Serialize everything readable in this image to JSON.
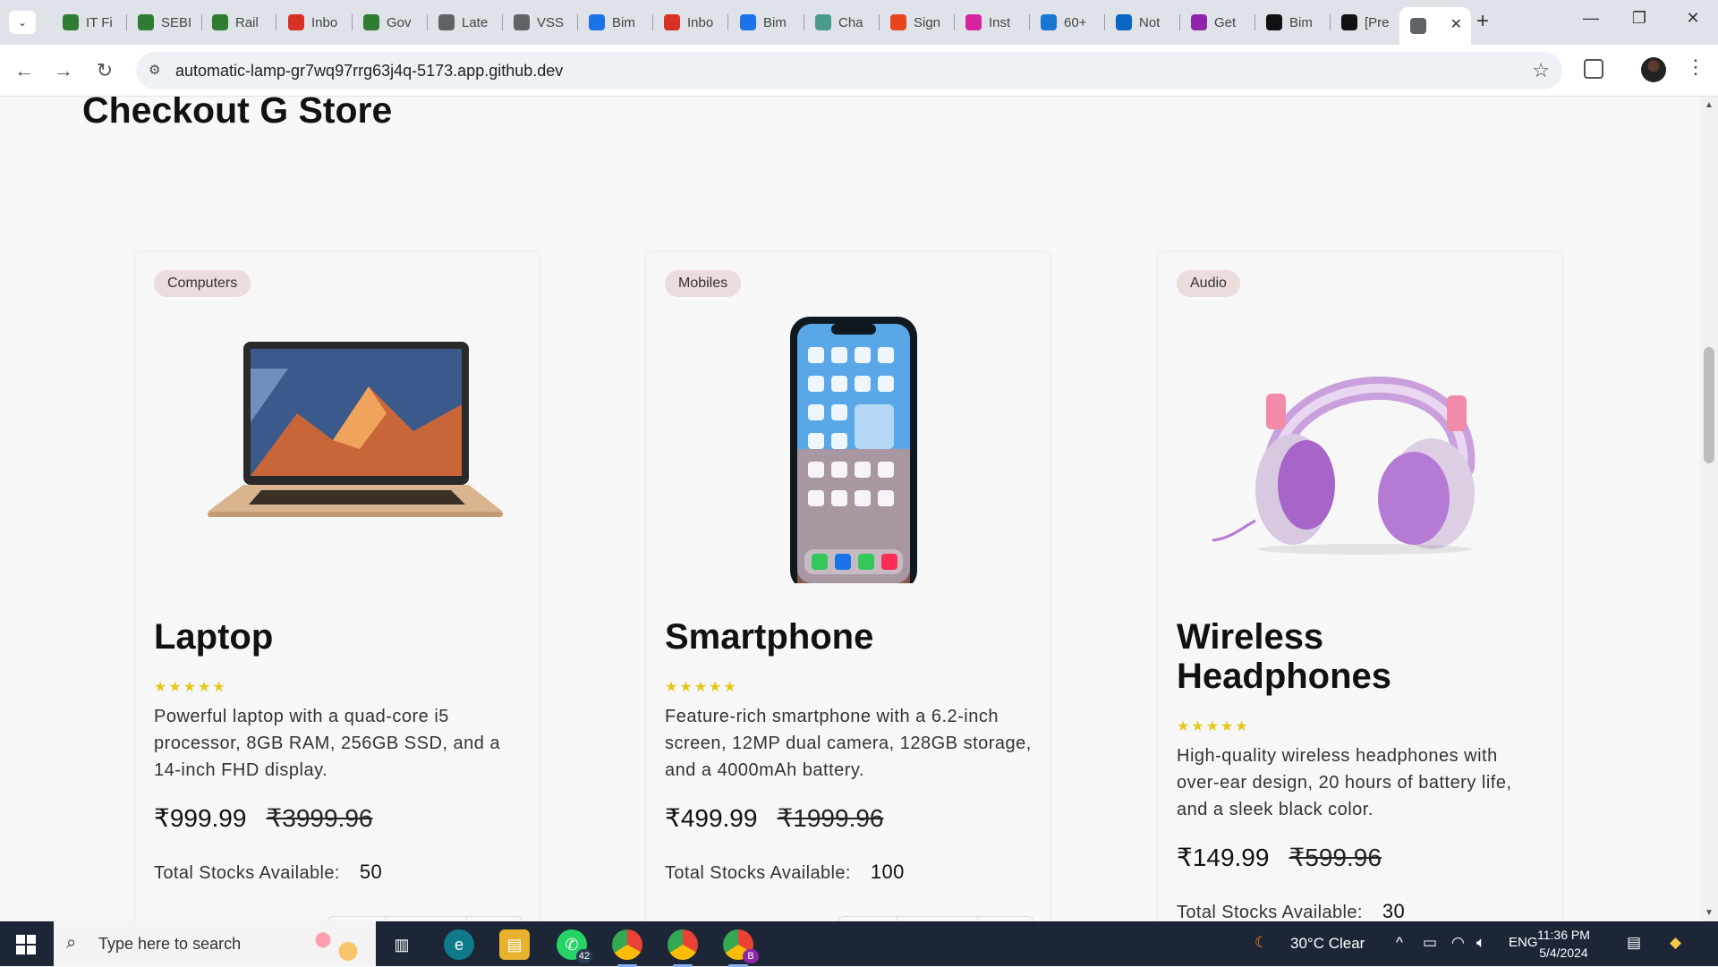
{
  "browser": {
    "tabs": [
      {
        "title": "IT Fi",
        "icon": "shield-icon",
        "color": "#2e7d32"
      },
      {
        "title": "SEBI",
        "icon": "shield-icon",
        "color": "#2e7d32"
      },
      {
        "title": "Rail",
        "icon": "shield-icon",
        "color": "#2e7d32"
      },
      {
        "title": "Inbo",
        "icon": "gmail-icon",
        "color": "#d93025"
      },
      {
        "title": "Gov",
        "icon": "shield-icon",
        "color": "#2e7d32"
      },
      {
        "title": "Late",
        "icon": "news-icon",
        "color": "#5f6368"
      },
      {
        "title": "VSS",
        "icon": "news-icon",
        "color": "#5f6368"
      },
      {
        "title": "Bim",
        "icon": "docs-icon",
        "color": "#1a73e8"
      },
      {
        "title": "Inbo",
        "icon": "gmail-icon",
        "color": "#d93025"
      },
      {
        "title": "Bim",
        "icon": "docs-icon",
        "color": "#1a73e8"
      },
      {
        "title": "Cha",
        "icon": "chatgpt-icon",
        "color": "#4a9b8a"
      },
      {
        "title": "Sign",
        "icon": "sign-icon",
        "color": "#e8451e"
      },
      {
        "title": "Inst",
        "icon": "instagram-icon",
        "color": "#d6249f"
      },
      {
        "title": "60+",
        "icon": "n-icon",
        "color": "#1976d2"
      },
      {
        "title": "Not",
        "icon": "linkedin-icon",
        "color": "#0a66c2"
      },
      {
        "title": "Get",
        "icon": "v-icon",
        "color": "#8e24aa"
      },
      {
        "title": "Bim",
        "icon": "github-icon",
        "color": "#111111"
      },
      {
        "title": "[Pre",
        "icon": "github-icon",
        "color": "#111111"
      },
      {
        "title": "",
        "icon": "globe-icon",
        "color": "#5f6368"
      }
    ],
    "url": "automatic-lamp-gr7wq97rrg63j4q-5173.app.github.dev"
  },
  "page": {
    "title": "Checkout G Store",
    "products": [
      {
        "category": "Computers",
        "name": "Laptop",
        "rating": 5,
        "description": "Powerful laptop with a quad-core i5 processor, 8GB RAM, 256GB SSD, and a 14-inch FHD display.",
        "price": "₹999.99",
        "original_price": "₹3999.96",
        "stock_label": "Total Stocks Available:",
        "stock": "50"
      },
      {
        "category": "Mobiles",
        "name": "Smartphone",
        "rating": 5,
        "description": "Feature-rich smartphone with a 6.2-inch screen, 12MP dual camera, 128GB storage, and a 4000mAh battery.",
        "price": "₹499.99",
        "original_price": "₹1999.96",
        "stock_label": "Total Stocks Available:",
        "stock": "100"
      },
      {
        "category": "Audio",
        "name": "Wireless Headphones",
        "rating": 5,
        "description": "High-quality wireless headphones with over-ear design, 20 hours of battery life, and a sleek black color.",
        "price": "₹149.99",
        "original_price": "₹599.96",
        "stock_label": "Total Stocks Available:",
        "stock": "30"
      }
    ]
  },
  "taskbar": {
    "search_placeholder": "Type here to search",
    "whatsapp_badge": "42",
    "chrome_badge": "B",
    "weather": "30°C  Clear",
    "language": "ENG",
    "time": "11:36 PM",
    "date": "5/4/2024"
  },
  "colors": {
    "badge_bg": "#ecdcdc",
    "star": "#e6c619",
    "taskbar": "#1c2637"
  }
}
